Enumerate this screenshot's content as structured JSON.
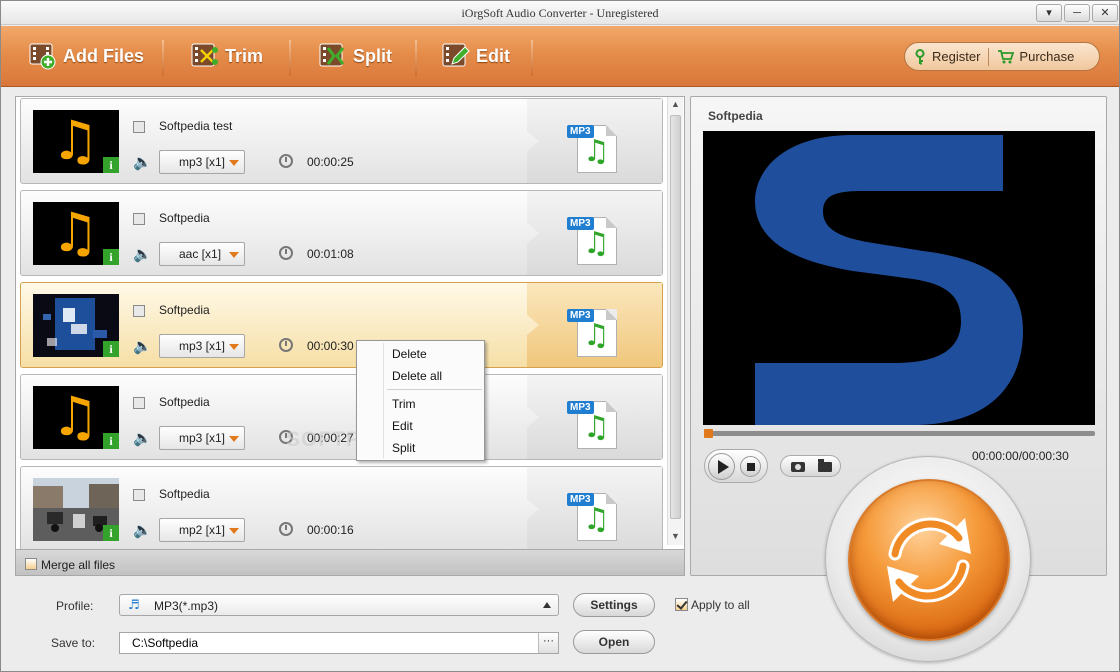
{
  "window": {
    "title": "iOrgSoft Audio Converter - Unregistered",
    "controls": [
      "▾",
      "─",
      "✕"
    ]
  },
  "toolbar": {
    "add_files": "Add Files",
    "trim": "Trim",
    "split": "Split",
    "edit": "Edit",
    "register": "Register",
    "purchase": "Purchase"
  },
  "files": [
    {
      "name": "Softpedia test",
      "format": "mp3 [x1]",
      "duration": "00:00:25",
      "output_tag": "MP3",
      "selected": false
    },
    {
      "name": "Softpedia",
      "format": "aac [x1]",
      "duration": "00:01:08",
      "output_tag": "MP3",
      "selected": false
    },
    {
      "name": "Softpedia",
      "format": "mp3 [x1]",
      "duration": "00:00:30",
      "output_tag": "MP3",
      "selected": true
    },
    {
      "name": "Softpedia",
      "format": "mp3 [x1]",
      "duration": "00:00:27",
      "output_tag": "MP3",
      "selected": false
    },
    {
      "name": "Softpedia",
      "format": "mp2 [x1]",
      "duration": "00:00:16",
      "output_tag": "MP3",
      "selected": false
    }
  ],
  "merge": {
    "label": "Merge all files",
    "checked": false
  },
  "context_menu": {
    "items": [
      "Delete",
      "Delete all",
      "Trim",
      "Edit",
      "Split"
    ]
  },
  "watermark": "SOFTPEDIA",
  "preview": {
    "title": "Softpedia",
    "timecode": "00:00:00/00:00:30",
    "progress": 0
  },
  "form": {
    "profile_label": "Profile:",
    "profile_value": "MP3(*.mp3)",
    "settings": "Settings",
    "apply_to_all": "Apply to all",
    "apply_checked": true,
    "save_label": "Save to:",
    "save_path": "C:\\Softpedia",
    "browse": "···",
    "open": "Open"
  },
  "colors": {
    "accent": "#e07a1c",
    "toolbar": "#e58d4a",
    "selected_row": "#f6dfa6",
    "output_note": "#2fa62a",
    "preview_logo": "#1f4f9c"
  }
}
